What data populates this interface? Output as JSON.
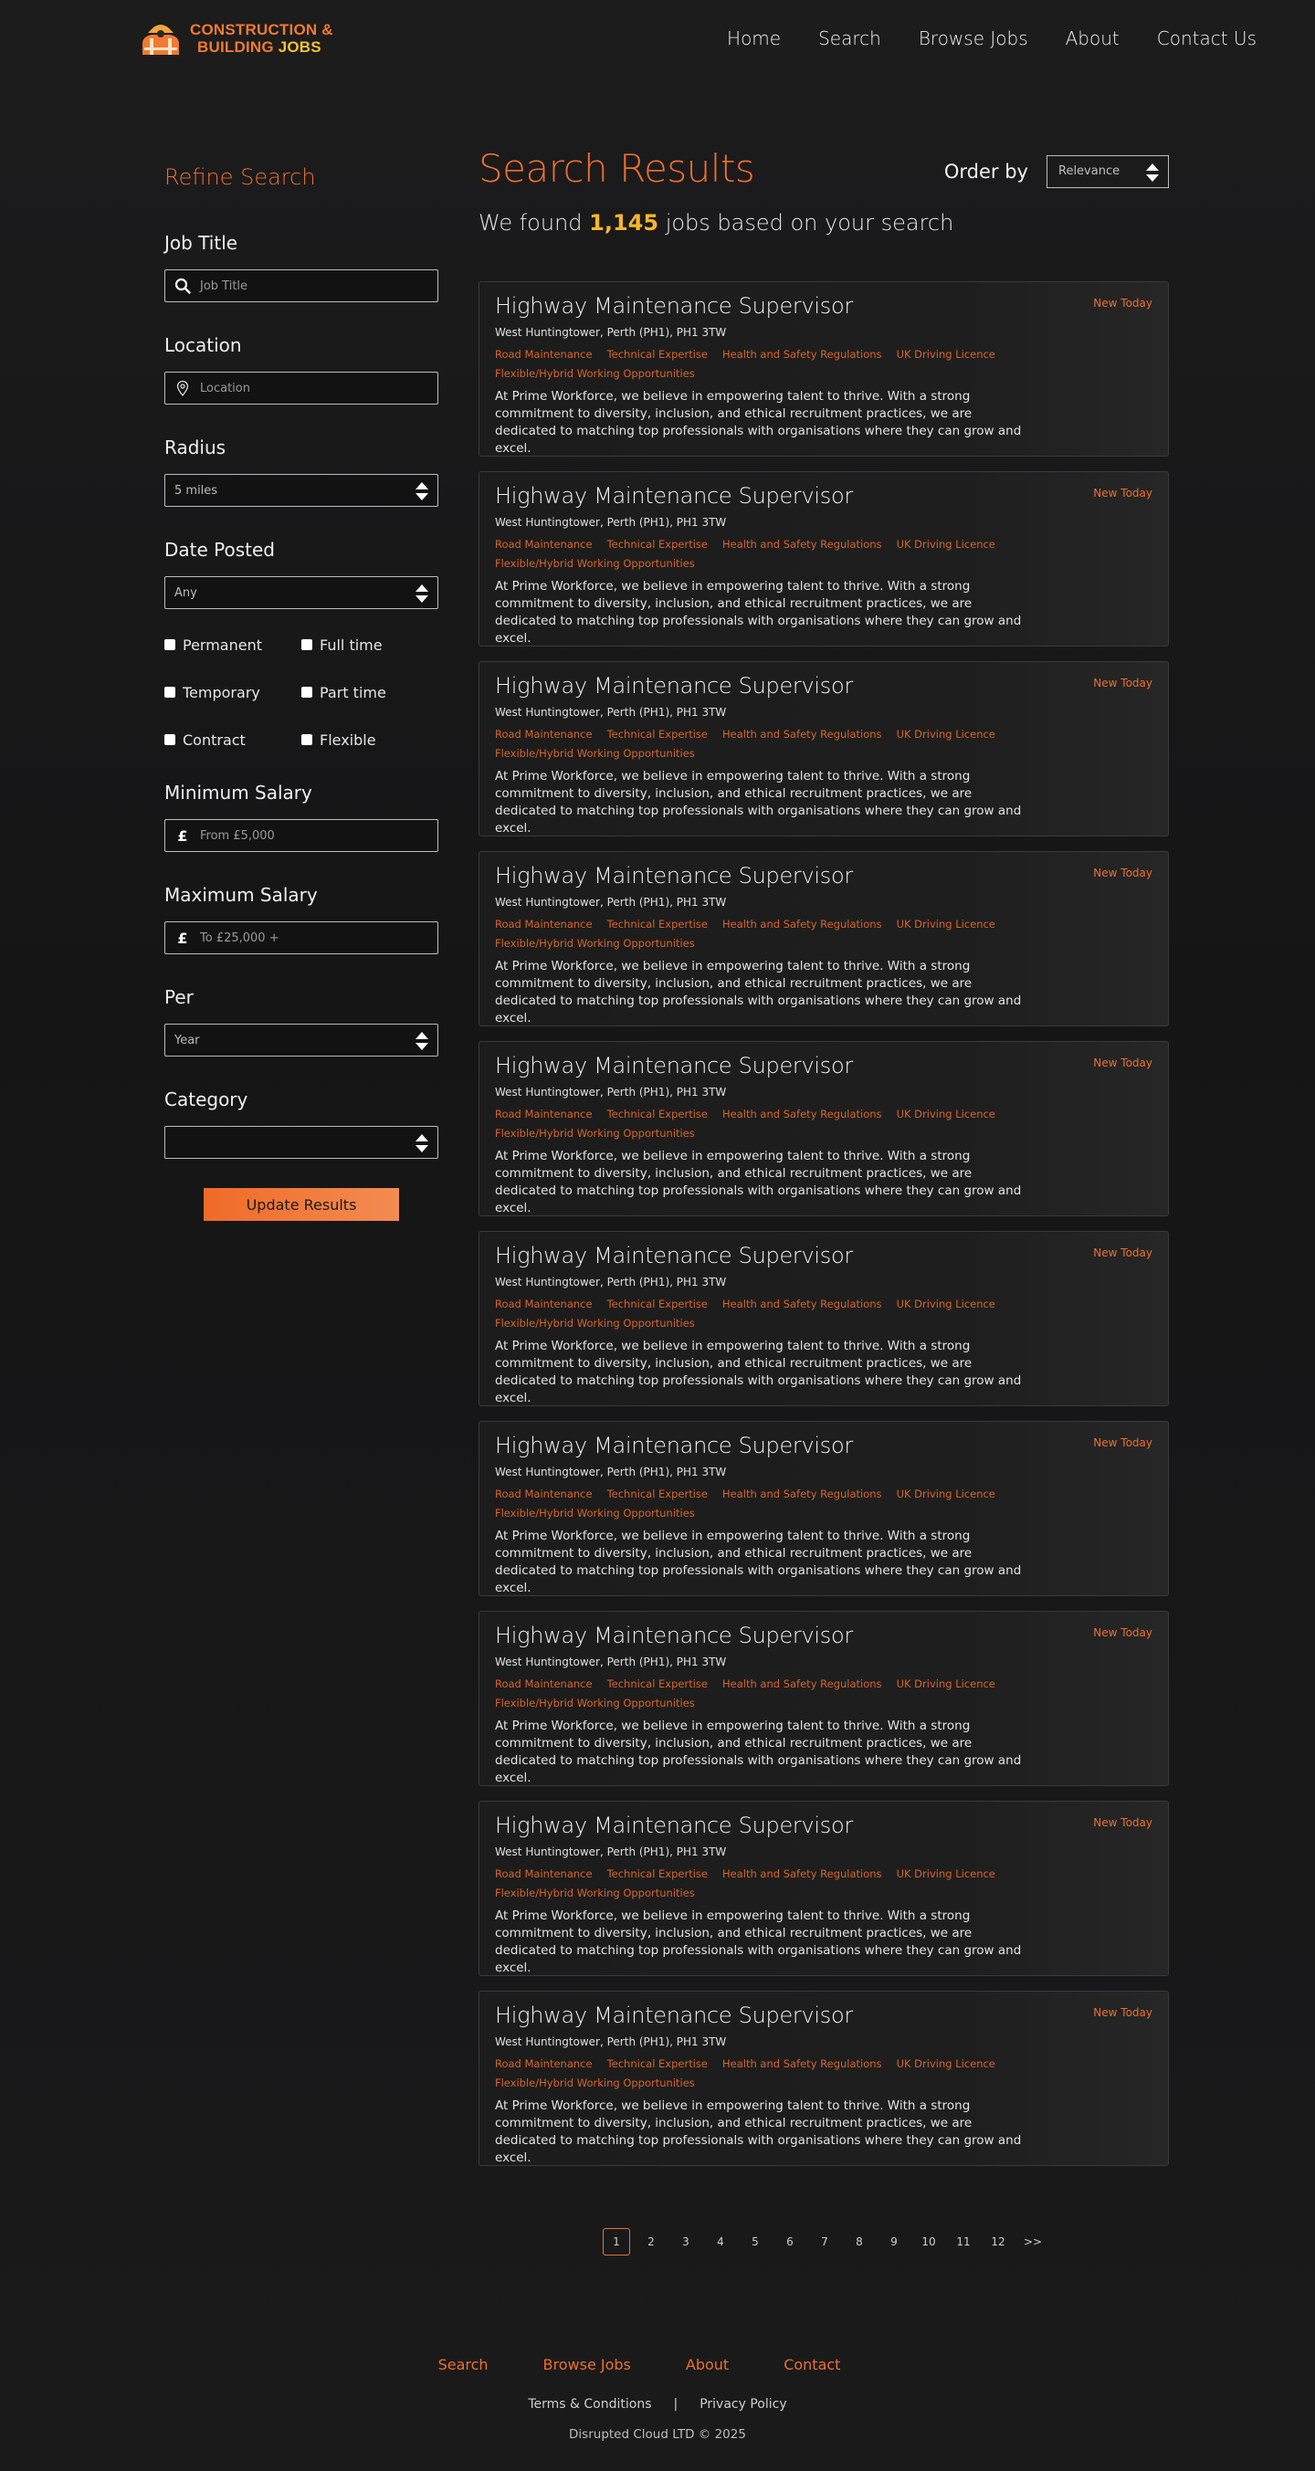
{
  "brand": {
    "line1": "CONSTRUCTION &",
    "line2_a": "BUILDING ",
    "line2_b": "JOBS"
  },
  "nav": [
    "Home",
    "Search",
    "Browse Jobs",
    "About",
    "Contact Us"
  ],
  "sidebar": {
    "title": "Refine Search",
    "job_title_label": "Job Title",
    "job_title_placeholder": "Job Title",
    "location_label": "Location",
    "location_placeholder": "Location",
    "radius_label": "Radius",
    "radius_value": "5 miles",
    "date_label": "Date Posted",
    "date_value": "Any",
    "checkboxes": [
      "Permanent",
      "Full time",
      "Temporary",
      "Part time",
      "Contract",
      "Flexible"
    ],
    "min_salary_label": "Minimum Salary",
    "min_salary_placeholder": "From £5,000",
    "max_salary_label": "Maximum Salary",
    "max_salary_placeholder": "To £25,000 +",
    "per_label": "Per",
    "per_value": "Year",
    "category_label": "Category",
    "category_value": "",
    "update_label": "Update Results",
    "currency_symbol": "£"
  },
  "results": {
    "title": "Search Results",
    "order_label": "Order by",
    "order_value": "Relevance",
    "found_prefix": "We found ",
    "found_count": "1,145",
    "found_suffix": " jobs based on your search"
  },
  "jobs": [
    {
      "title": "Highway Maintenance Supervisor",
      "badge": "New Today",
      "location": "West Huntingtower, Perth (PH1), PH1 3TW",
      "tags": [
        "Road Maintenance",
        "Technical Expertise",
        "Health and Safety Regulations",
        "UK Driving Licence",
        "Flexible/Hybrid Working Opportunities"
      ],
      "description": "At Prime Workforce, we believe in empowering talent to thrive. With a strong commitment to diversity, inclusion, and ethical recruitment practices, we are dedicated to matching top professionals with organisations where they can grow and excel."
    },
    {
      "title": "Highway Maintenance Supervisor",
      "badge": "New Today",
      "location": "West Huntingtower, Perth (PH1), PH1 3TW",
      "tags": [
        "Road Maintenance",
        "Technical Expertise",
        "Health and Safety Regulations",
        "UK Driving Licence",
        "Flexible/Hybrid Working Opportunities"
      ],
      "description": "At Prime Workforce, we believe in empowering talent to thrive. With a strong commitment to diversity, inclusion, and ethical recruitment practices, we are dedicated to matching top professionals with organisations where they can grow and excel."
    },
    {
      "title": "Highway Maintenance Supervisor",
      "badge": "New Today",
      "location": "West Huntingtower, Perth (PH1), PH1 3TW",
      "tags": [
        "Road Maintenance",
        "Technical Expertise",
        "Health and Safety Regulations",
        "UK Driving Licence",
        "Flexible/Hybrid Working Opportunities"
      ],
      "description": "At Prime Workforce, we believe in empowering talent to thrive. With a strong commitment to diversity, inclusion, and ethical recruitment practices, we are dedicated to matching top professionals with organisations where they can grow and excel."
    },
    {
      "title": "Highway Maintenance Supervisor",
      "badge": "New Today",
      "location": "West Huntingtower, Perth (PH1), PH1 3TW",
      "tags": [
        "Road Maintenance",
        "Technical Expertise",
        "Health and Safety Regulations",
        "UK Driving Licence",
        "Flexible/Hybrid Working Opportunities"
      ],
      "description": "At Prime Workforce, we believe in empowering talent to thrive. With a strong commitment to diversity, inclusion, and ethical recruitment practices, we are dedicated to matching top professionals with organisations where they can grow and excel."
    },
    {
      "title": "Highway Maintenance Supervisor",
      "badge": "New Today",
      "location": "West Huntingtower, Perth (PH1), PH1 3TW",
      "tags": [
        "Road Maintenance",
        "Technical Expertise",
        "Health and Safety Regulations",
        "UK Driving Licence",
        "Flexible/Hybrid Working Opportunities"
      ],
      "description": "At Prime Workforce, we believe in empowering talent to thrive. With a strong commitment to diversity, inclusion, and ethical recruitment practices, we are dedicated to matching top professionals with organisations where they can grow and excel."
    },
    {
      "title": "Highway Maintenance Supervisor",
      "badge": "New Today",
      "location": "West Huntingtower, Perth (PH1), PH1 3TW",
      "tags": [
        "Road Maintenance",
        "Technical Expertise",
        "Health and Safety Regulations",
        "UK Driving Licence",
        "Flexible/Hybrid Working Opportunities"
      ],
      "description": "At Prime Workforce, we believe in empowering talent to thrive. With a strong commitment to diversity, inclusion, and ethical recruitment practices, we are dedicated to matching top professionals with organisations where they can grow and excel."
    },
    {
      "title": "Highway Maintenance Supervisor",
      "badge": "New Today",
      "location": "West Huntingtower, Perth (PH1), PH1 3TW",
      "tags": [
        "Road Maintenance",
        "Technical Expertise",
        "Health and Safety Regulations",
        "UK Driving Licence",
        "Flexible/Hybrid Working Opportunities"
      ],
      "description": "At Prime Workforce, we believe in empowering talent to thrive. With a strong commitment to diversity, inclusion, and ethical recruitment practices, we are dedicated to matching top professionals with organisations where they can grow and excel."
    },
    {
      "title": "Highway Maintenance Supervisor",
      "badge": "New Today",
      "location": "West Huntingtower, Perth (PH1), PH1 3TW",
      "tags": [
        "Road Maintenance",
        "Technical Expertise",
        "Health and Safety Regulations",
        "UK Driving Licence",
        "Flexible/Hybrid Working Opportunities"
      ],
      "description": "At Prime Workforce, we believe in empowering talent to thrive. With a strong commitment to diversity, inclusion, and ethical recruitment practices, we are dedicated to matching top professionals with organisations where they can grow and excel."
    },
    {
      "title": "Highway Maintenance Supervisor",
      "badge": "New Today",
      "location": "West Huntingtower, Perth (PH1), PH1 3TW",
      "tags": [
        "Road Maintenance",
        "Technical Expertise",
        "Health and Safety Regulations",
        "UK Driving Licence",
        "Flexible/Hybrid Working Opportunities"
      ],
      "description": "At Prime Workforce, we believe in empowering talent to thrive. With a strong commitment to diversity, inclusion, and ethical recruitment practices, we are dedicated to matching top professionals with organisations where they can grow and excel."
    },
    {
      "title": "Highway Maintenance Supervisor",
      "badge": "New Today",
      "location": "West Huntingtower, Perth (PH1), PH1 3TW",
      "tags": [
        "Road Maintenance",
        "Technical Expertise",
        "Health and Safety Regulations",
        "UK Driving Licence",
        "Flexible/Hybrid Working Opportunities"
      ],
      "description": "At Prime Workforce, we believe in empowering talent to thrive. With a strong commitment to diversity, inclusion, and ethical recruitment practices, we are dedicated to matching top professionals with organisations where they can grow and excel."
    }
  ],
  "pagination": {
    "pages": [
      "1",
      "2",
      "3",
      "4",
      "5",
      "6",
      "7",
      "8",
      "9",
      "10",
      "11",
      "12",
      ">>"
    ],
    "active": "1"
  },
  "footer": {
    "links": [
      "Search",
      "Browse Jobs",
      "About",
      "Contact"
    ],
    "terms": "Terms & Conditions",
    "separator": "|",
    "privacy": "Privacy Policy",
    "copyright": "Disrupted Cloud LTD © 2025"
  },
  "colors": {
    "accent": "#ec6f30",
    "highlight": "#f6b52b",
    "background": "#161617"
  },
  "icons": {
    "job_title": "search-icon",
    "location": "map-pin-icon",
    "select": "updown-arrows-icon"
  }
}
